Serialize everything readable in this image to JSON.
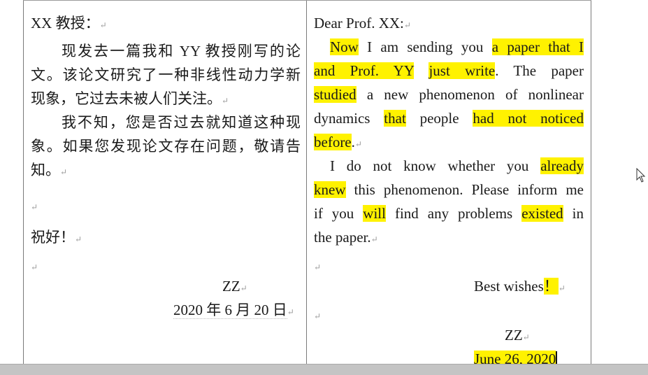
{
  "chinese": {
    "greeting": "XX 教授：",
    "p1_lines": [
      "现发去一篇我和 YY 教授刚写的论",
      "文。该论文研究了一种非线性动力学新",
      "现象，它过去未被人们关注。"
    ],
    "p2_lines": [
      "我不知，您是否过去就知道这种现",
      "象。如果您发现论文存在问题，敬请告",
      "知。"
    ],
    "closing": "祝好！",
    "signature": "ZZ",
    "date": "2020 年 6 月 20 日"
  },
  "english": {
    "greeting": "Dear Prof. XX:",
    "p1": {
      "l1": [
        "Now",
        " I am sending you ",
        "a paper that I"
      ],
      "l2": [
        "and Prof. YY",
        " ",
        "just write",
        ". The paper"
      ],
      "l3": [
        "studied",
        " a new phenomenon of nonlinear"
      ],
      "l4": [
        "dynamics ",
        "that",
        " people ",
        "had not noticed"
      ],
      "l5": [
        "before",
        "."
      ]
    },
    "p2": {
      "l1": [
        "I do not know whether you ",
        "already"
      ],
      "l2": [
        "knew",
        " this phenomenon. Please inform me"
      ],
      "l3": [
        "if you ",
        "will",
        " find any problems ",
        "existed",
        " in"
      ],
      "l4": [
        "the paper."
      ]
    },
    "closing": [
      "Best wishes",
      "！"
    ],
    "signature": "ZZ",
    "date": "June 26, 2020"
  },
  "highlight_color": "#fff200",
  "icons": [
    "paragraph-mark-icon",
    "mouse-cursor-icon"
  ]
}
